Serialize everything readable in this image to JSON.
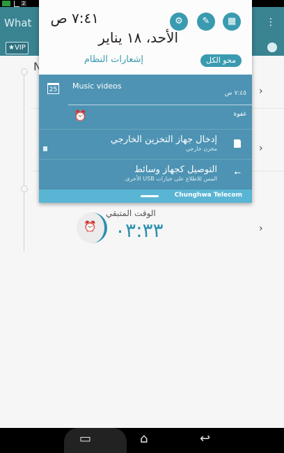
{
  "status_bar": {
    "notification_count": "2"
  },
  "app": {
    "title": "What",
    "vip_chip": "★VIP",
    "list_initial": "N",
    "remaining_label": "الوقت المتبقي",
    "remaining_value": "٠٣:٣٣"
  },
  "shade": {
    "time": "٧:٤١ ص",
    "date": "الأحد، ١٨ يناير",
    "system_notifications": "إشعارات النظام",
    "clear_all": "محو الكل",
    "quick_settings": [
      {
        "icon": "gear-icon",
        "glyph": "⚙"
      },
      {
        "icon": "edit-icon",
        "glyph": "✎"
      },
      {
        "icon": "grid-icon",
        "glyph": "▦"
      }
    ],
    "notifications": [
      {
        "title": "Music videos",
        "time": "٧:٤٥ ص",
        "calendar_day": "25",
        "action": "غفوة"
      },
      {
        "title": "إدخال جهاز التخزين الخارجي",
        "subtitle": "مخزن خارجي"
      },
      {
        "title": "التوصيل كجهاز وسائط",
        "subtitle": "المس للاطلاع على خيارات USB الأخرى."
      }
    ],
    "carrier": "Chunghwa Telecom"
  }
}
